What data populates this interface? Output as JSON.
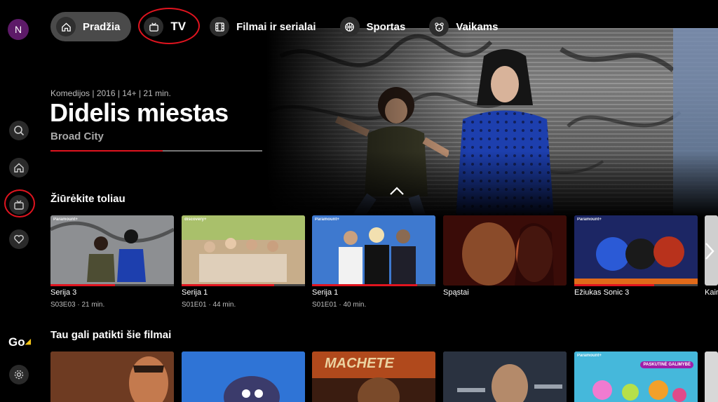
{
  "user": {
    "initial": "N"
  },
  "nav": {
    "items": [
      {
        "label": "Pradžia",
        "icon": "home-icon",
        "active": true
      },
      {
        "label": "TV",
        "icon": "tv-icon",
        "active": false
      },
      {
        "label": "Filmai ir serialai",
        "icon": "film-icon",
        "active": false
      },
      {
        "label": "Sportas",
        "icon": "ball-icon",
        "active": false
      },
      {
        "label": "Vaikams",
        "icon": "bear-icon",
        "active": false
      }
    ]
  },
  "sidebar": {
    "icons": [
      "search-icon",
      "home-icon",
      "tv-icon",
      "heart-icon",
      "settings-icon"
    ],
    "brand": "Go"
  },
  "hero": {
    "meta": "Komedijos | 2016 | 14+ | 21 min.",
    "title": "Didelis miestas",
    "subtitle": "Broad City",
    "progress": 0.53
  },
  "rows": [
    {
      "title": "Žiūrėkite toliau",
      "cards": [
        {
          "title": "Serija 3",
          "sub": "S03E03 · 21 min.",
          "badge": "Paramount+",
          "progress": 0.52,
          "color": "#7b7f85"
        },
        {
          "title": "Serija 1",
          "sub": "S01E01 · 44 min.",
          "badge": "discovery+",
          "progress": 0.75,
          "color": "#b69a77"
        },
        {
          "title": "Serija 1",
          "sub": "S01E01 · 40 min.",
          "badge": "Paramount+",
          "progress": 0.85,
          "color": "#3d6fbf"
        },
        {
          "title": "Spąstai",
          "sub": "",
          "badge": "",
          "progress": 0,
          "color": "#6a1d14"
        },
        {
          "title": "Ežiukas Sonic 3",
          "sub": "",
          "badge": "Paramount+",
          "progress": 0.65,
          "color": "#2d3f86"
        },
        {
          "title": "Kair",
          "sub": "",
          "badge": "",
          "progress": 0,
          "color": "#cfcfcf"
        }
      ]
    },
    {
      "title": "Tau gali patikti šie filmai",
      "cards": [
        {
          "title": "",
          "badge": "",
          "color": "#8a4a2a"
        },
        {
          "title": "",
          "badge": "",
          "color": "#3a7bd0"
        },
        {
          "title": "",
          "badge": "MACHETE",
          "color": "#b24a1c"
        },
        {
          "title": "",
          "badge": "",
          "color": "#5a6470"
        },
        {
          "title": "",
          "badge": "Paramount+",
          "tag": "PASKUTINĖ GALIMYBĖ",
          "color": "#47b7d6"
        },
        {
          "title": "",
          "badge": "",
          "color": "#d8d8d8"
        }
      ]
    }
  ],
  "colors": {
    "accent": "#e0141f",
    "navActive": "#4a4a4a"
  }
}
